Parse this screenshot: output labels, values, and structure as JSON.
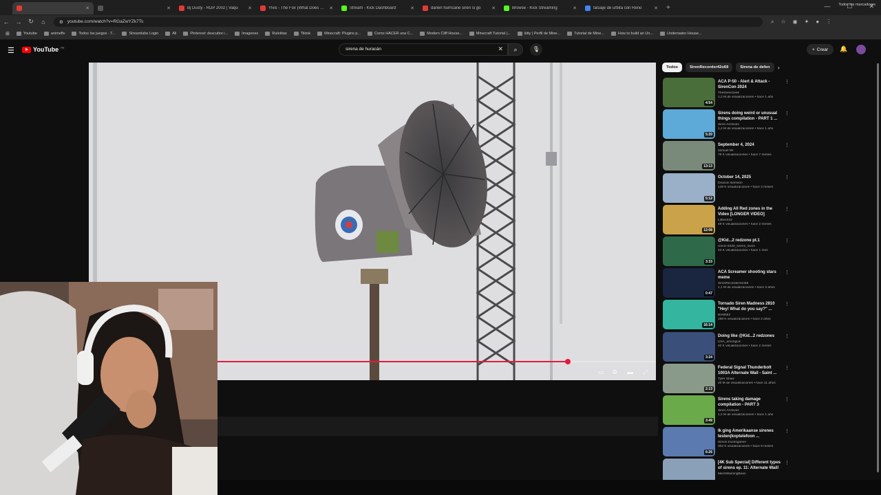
{
  "browser": {
    "tabs": [
      {
        "title": "",
        "color": "#e53935",
        "active": true
      },
      {
        "title": "",
        "color": "#555555",
        "active": false
      },
      {
        "title": "Bj Dusty - RDP 2002 | Vaqu",
        "color": "#e53935",
        "active": false
      },
      {
        "title": "Ylvis - The Fox (What Does The",
        "color": "#e53935",
        "active": false
      },
      {
        "title": "Stream - Kick Dashboard",
        "color": "#53fc18",
        "active": false
      },
      {
        "title": "darien hurricane siren si go",
        "color": "#e53935",
        "active": false
      },
      {
        "title": "Browse - Kick Streaming",
        "color": "#53fc18",
        "active": false
      },
      {
        "title": "tatuaje de urbita con Reno",
        "color": "#4285f4",
        "active": false
      }
    ],
    "url": "youtube.com/watch?v=RGaZwYZk7Ts",
    "bookmarks": [
      "Youtube",
      "animeflv",
      "Todos los juegos - T...",
      "Streamlabs Login",
      "All",
      "Pinterest: descubre i...",
      "Imagenes",
      "Ruletitas",
      "Tiktok",
      "Minecraft: Plugins p...",
      "Como HACER una C...",
      "Modern Cliff House...",
      "Minecraft Tutorial |...",
      "kitty | Perfil de Mine...",
      "Tutorial de Mine...",
      "How to build an Un...",
      "Underwater House..."
    ],
    "bookmarks_all": "Todos los marcadores"
  },
  "youtube": {
    "logo_text": "YouTube",
    "logo_country": "PE",
    "search_value": "sirena de huracán",
    "create_label": "Crear",
    "progress": 0.8
  },
  "chips": [
    "Todos",
    "SirenRecorder42o69",
    "Sirena de defen"
  ],
  "recommendations": [
    {
      "title": "ACA P-50 - Alert & Attack - SirenCon 2024",
      "channel": "TheSirenGeek",
      "meta": "1,2 M de visualizaciones • hace 1 año",
      "duration": "4:54",
      "thumb": "#4a6e3a"
    },
    {
      "title": "Sirens doing weird or unusual things compilation - PART 1 ...",
      "channel": "Siren Archives",
      "meta": "1,4 M de visualizaciones • hace 1 año",
      "duration": "5:20",
      "thumb": "#5da9d8"
    },
    {
      "title": "September 4, 2024",
      "channel": "samuel Mr",
      "meta": "79 K visualizaciones • hace 7 meses",
      "duration": "13:13",
      "thumb": "#7a8a7a"
    },
    {
      "title": "October 14, 2025",
      "channel": "Deacon siemson",
      "meta": "149 K visualizaciones • hace 4 meses",
      "duration": "5:12",
      "thumb": "#9ab0c8"
    },
    {
      "title": "Adding All Red zones in the Video [LONGER VIDEO]",
      "channel": "Lilbee342",
      "meta": "49 K visualizaciones • hace 2 meses",
      "duration": "12:08",
      "thumb": "#c9a24a"
    },
    {
      "title": "@Kid...2 redzone pt.1",
      "channel": "Union 5330_sirens_loves",
      "meta": "43 K visualizaciones • hace 1 mes",
      "duration": "3:33",
      "thumb": "#2e6a4a"
    },
    {
      "title": "ACA Screamer shooting stars meme",
      "channel": "SirenRecorder42o69",
      "meta": "1,1 M de visualizaciones • hace 3 años",
      "duration": "0:47",
      "thumb": "#1a2540"
    },
    {
      "title": "Tornado Siren Madness 2810 \"Hey! What do you say?\" ...",
      "channel": "Brett552",
      "meta": "158 K visualizaciones • hace 2 años",
      "duration": "16:14",
      "thumb": "#33b5a0"
    },
    {
      "title": "Doing like @Kid...2 redzones",
      "channel": "USA_amongUs",
      "meta": "40 K visualizaciones • hace 2 meses",
      "duration": "3:24",
      "thumb": "#3a4f7a"
    },
    {
      "title": "Federal Signal Thunderbolt 1003A Alternate Wail - Saint ...",
      "channel": "Tyler Shaw",
      "meta": "20 M de visualizaciones • hace 11 años",
      "duration": "2:13",
      "thumb": "#8a9a8a"
    },
    {
      "title": "Sirens taking damage compilation - PART 3",
      "channel": "Siren Archives",
      "meta": "1,2 M de visualizaciones • hace 1 año",
      "duration": "3:49",
      "thumb": "#6aaa4a"
    },
    {
      "title": "Ik ging Amerikaanse sirenes testen(koptelefoon ...",
      "channel": "Simon trucksgamer",
      "meta": "302 K visualizaciones • hace 9 meses",
      "duration": "6:26",
      "thumb": "#5a7ab0"
    },
    {
      "title": "[4K Sub Special] Different types of sirens ep. 11: Alternate Wail!",
      "channel": "MiersWarningBean",
      "meta": "",
      "duration": "",
      "thumb": "#8aa0b8"
    }
  ]
}
